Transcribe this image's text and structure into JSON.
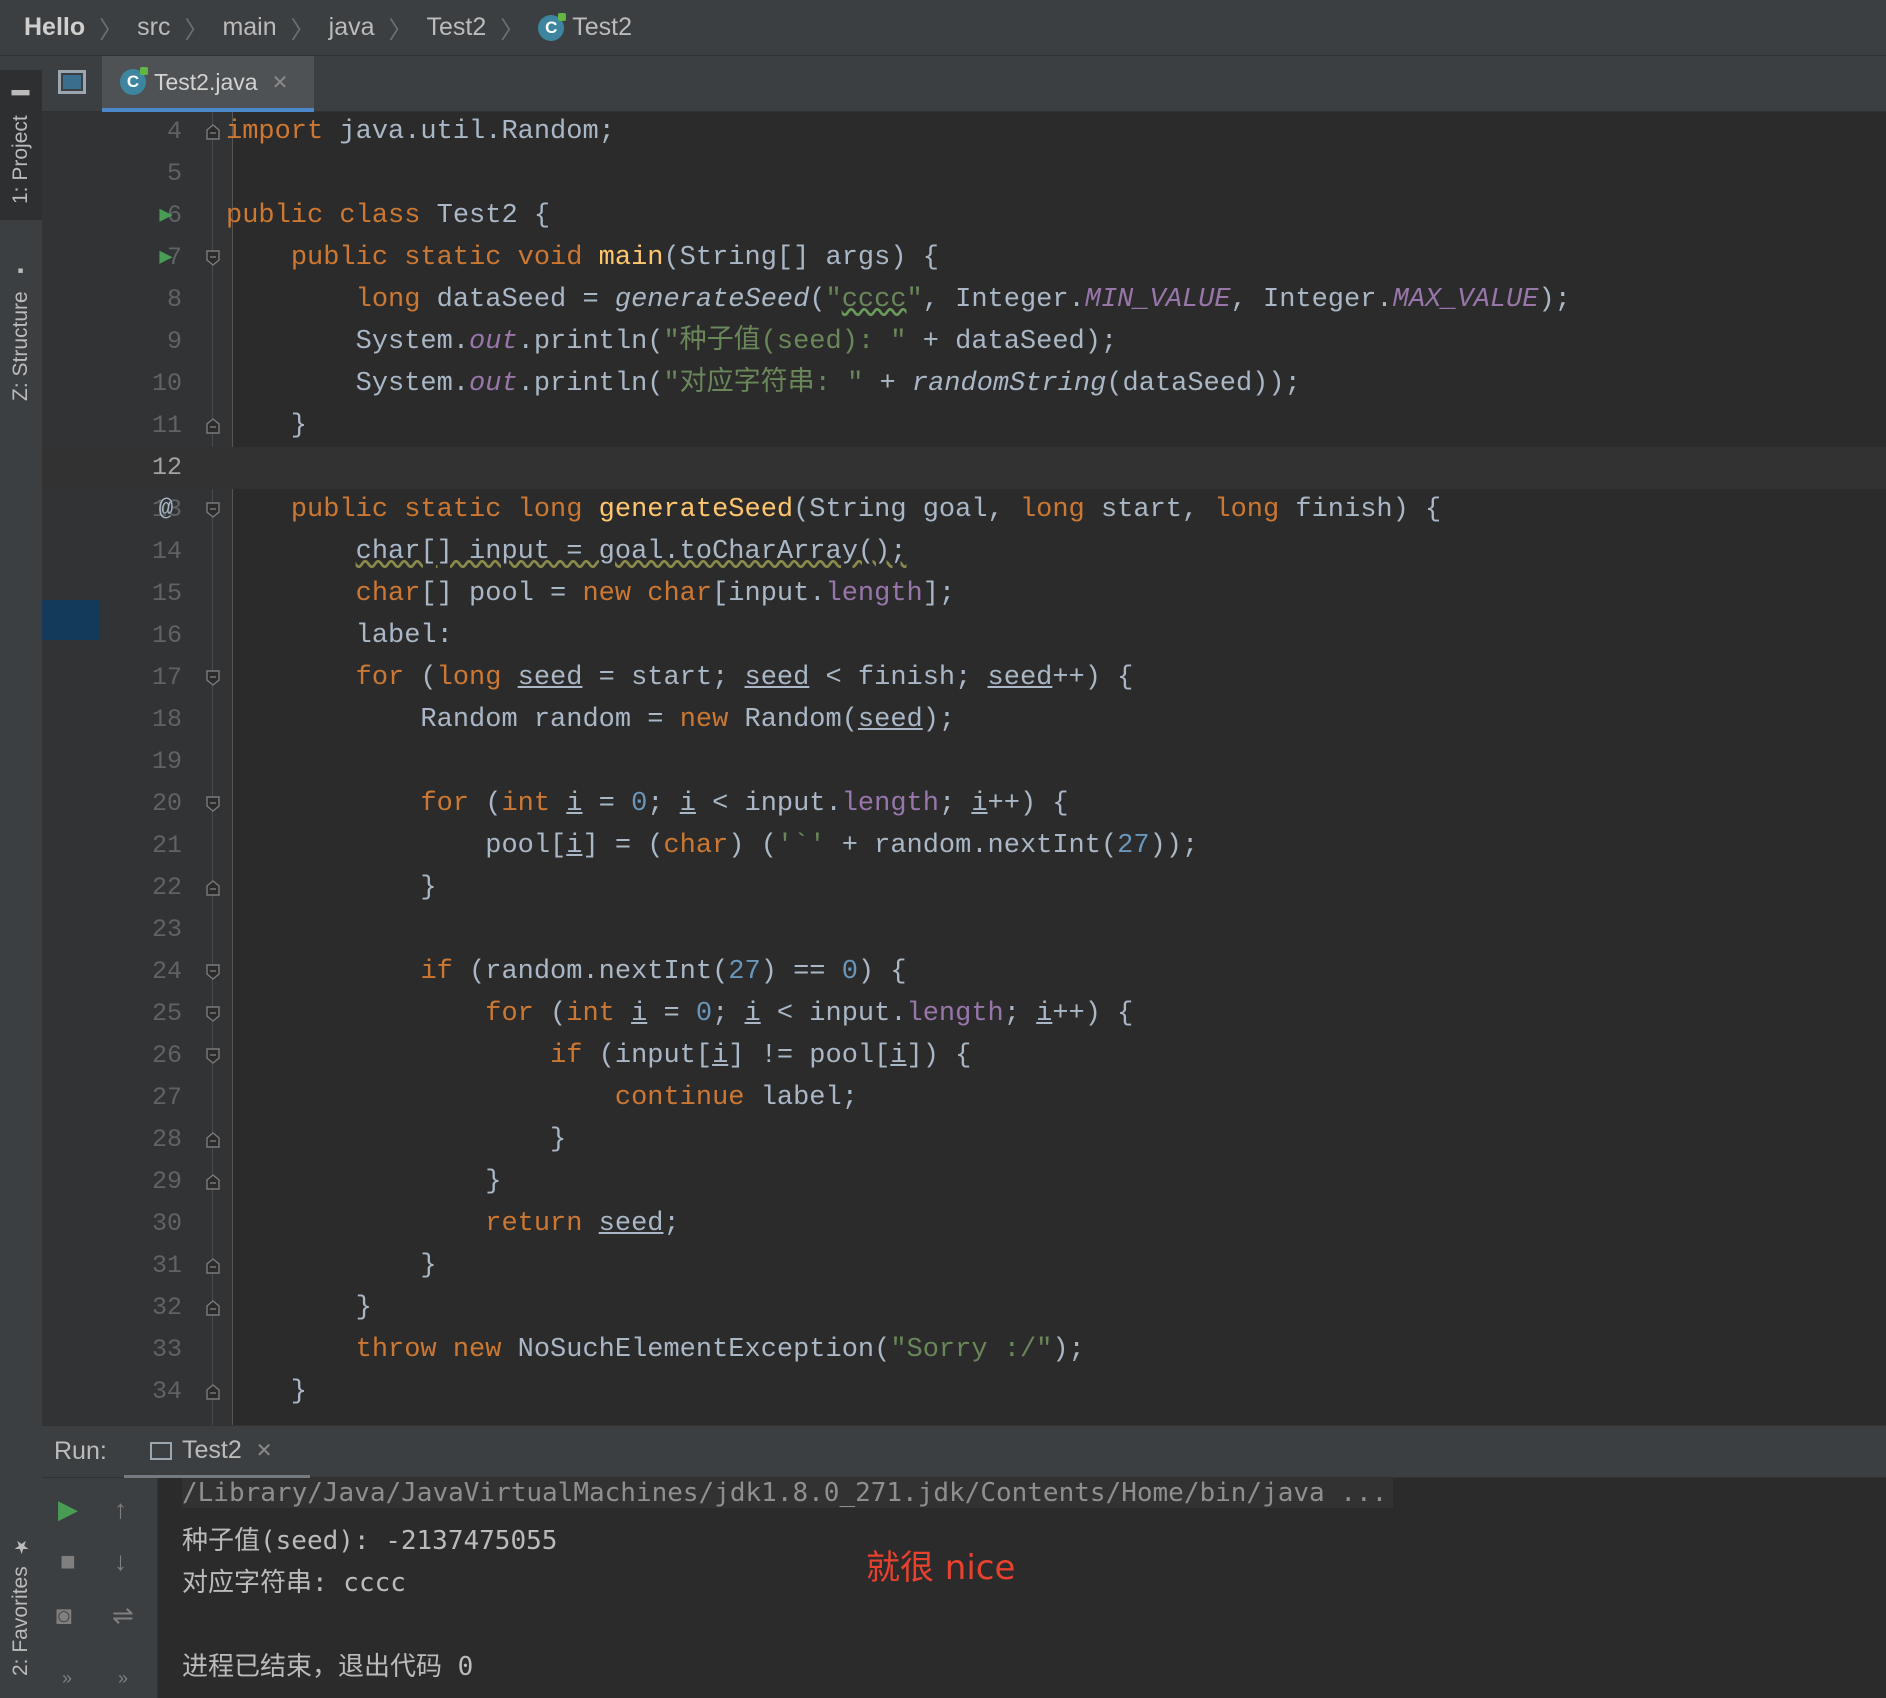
{
  "breadcrumb": {
    "items": [
      "Hello",
      "src",
      "main",
      "java",
      "Test2",
      "Test2"
    ]
  },
  "left_strip": {
    "project_tab": "1: Project",
    "structure_tab": "Z: Structure",
    "favorites_tab": "2: Favorites"
  },
  "editor_tab": {
    "file_name": "Test2.java",
    "icon": "java-class-icon"
  },
  "editor": {
    "current_line": 12,
    "lines": [
      {
        "n": "4"
      },
      {
        "n": "5"
      },
      {
        "n": "6"
      },
      {
        "n": "7"
      },
      {
        "n": "8"
      },
      {
        "n": "9"
      },
      {
        "n": "10"
      },
      {
        "n": "11"
      },
      {
        "n": "12"
      },
      {
        "n": "13"
      },
      {
        "n": "14"
      },
      {
        "n": "15"
      },
      {
        "n": "16"
      },
      {
        "n": "17"
      },
      {
        "n": "18"
      },
      {
        "n": "19"
      },
      {
        "n": "20"
      },
      {
        "n": "21"
      },
      {
        "n": "22"
      },
      {
        "n": "23"
      },
      {
        "n": "24"
      },
      {
        "n": "25"
      },
      {
        "n": "26"
      },
      {
        "n": "27"
      },
      {
        "n": "28"
      },
      {
        "n": "29"
      },
      {
        "n": "30"
      },
      {
        "n": "31"
      },
      {
        "n": "32"
      },
      {
        "n": "33"
      },
      {
        "n": "34"
      }
    ],
    "code": {
      "l4": [
        "import",
        " java.util.Random;"
      ],
      "l6": [
        "public",
        " ",
        "class",
        " Test2 {"
      ],
      "l7": [
        "    ",
        "public",
        " ",
        "static",
        " ",
        "void",
        " ",
        "main",
        "(String[] args) {"
      ],
      "l8": [
        "        ",
        "long",
        " dataSeed = ",
        "generateSeed",
        "(",
        "\"",
        "cccc",
        "\"",
        ", Integer.",
        "MIN_VALUE",
        ", Integer.",
        "MAX_VALUE",
        ");"
      ],
      "l9": [
        "        System.",
        "out",
        ".println(",
        "\"种子值(seed): \"",
        " + dataSeed);"
      ],
      "l10": [
        "        System.",
        "out",
        ".println(",
        "\"对应字符串: \"",
        " + ",
        "randomString",
        "(dataSeed));"
      ],
      "l11": [
        "    }"
      ],
      "l13": [
        "    ",
        "public",
        " ",
        "static",
        " ",
        "long",
        " ",
        "generateSeed",
        "(String goal, ",
        "long",
        " start, ",
        "long",
        " finish) {"
      ],
      "l14": [
        "        ",
        "char[] input = goal.toCharArray();"
      ],
      "l15": [
        "        ",
        "char",
        "[] pool = ",
        "new",
        " ",
        "char",
        "[input.",
        "length",
        "];"
      ],
      "l16": [
        "        label:"
      ],
      "l17": [
        "        ",
        "for",
        " (",
        "long",
        " ",
        "seed",
        " = start; ",
        "seed",
        " < finish; ",
        "seed",
        "++) {"
      ],
      "l18": [
        "            Random random = ",
        "new",
        " Random(",
        "seed",
        ");"
      ],
      "l20": [
        "            ",
        "for",
        " (",
        "int",
        " ",
        "i",
        " = ",
        "0",
        "; ",
        "i",
        " < input.",
        "length",
        "; ",
        "i",
        "++) {"
      ],
      "l21": [
        "                pool[",
        "i",
        "] = (",
        "char",
        ") (",
        "'`'",
        " + random.nextInt(",
        "27",
        "));"
      ],
      "l22": [
        "            }"
      ],
      "l24": [
        "            ",
        "if",
        " (random.nextInt(",
        "27",
        ") == ",
        "0",
        ") {"
      ],
      "l25": [
        "                ",
        "for",
        " (",
        "int",
        " ",
        "i",
        " = ",
        "0",
        "; ",
        "i",
        " < input.",
        "length",
        "; ",
        "i",
        "++) {"
      ],
      "l26": [
        "                    ",
        "if",
        " (input[",
        "i",
        "] != pool[",
        "i",
        "]) {"
      ],
      "l27": [
        "                        ",
        "continue",
        " label;"
      ],
      "l28": [
        "                    }"
      ],
      "l29": [
        "                }"
      ],
      "l30": [
        "                ",
        "return",
        " ",
        "seed",
        ";"
      ],
      "l31": [
        "            }"
      ],
      "l32": [
        "        }"
      ],
      "l33": [
        "        ",
        "throw",
        " ",
        "new",
        " NoSuchElementException(",
        "\"Sorry :/\"",
        ");"
      ],
      "l34": [
        "    }"
      ]
    }
  },
  "run_panel": {
    "label": "Run:",
    "tab_name": "Test2",
    "console": {
      "command": "/Library/Java/JavaVirtualMachines/jdk1.8.0_271.jdk/Contents/Home/bin/java ...",
      "seed_line": "种子值(seed): -2137475055",
      "string_line": "对应字符串: cccc",
      "exit_line": "进程已结束，退出代码 0"
    },
    "annotation": "就很 nice"
  },
  "colors": {
    "background": "#2b2b2b",
    "keyword": "#cc7832",
    "function": "#ffc66d",
    "string": "#6a8759",
    "number": "#6897bb",
    "field": "#9876aa",
    "annotation": "#e8412e"
  }
}
